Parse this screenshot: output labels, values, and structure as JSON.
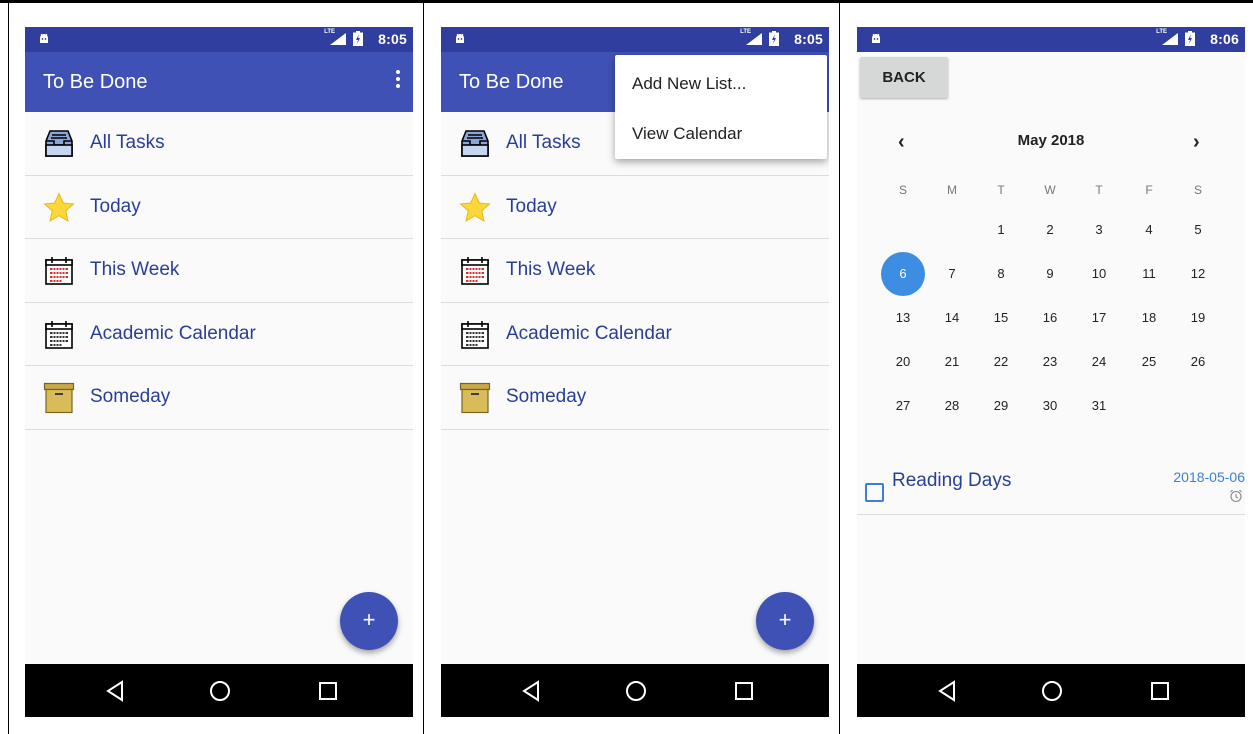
{
  "status": {
    "lte": "LTE",
    "time_a": "8:05",
    "time_b": "8:05",
    "time_c": "8:06"
  },
  "app": {
    "title": "To Be Done"
  },
  "lists": [
    {
      "label": "All Tasks",
      "icon": "inbox-tray-icon"
    },
    {
      "label": "Today",
      "icon": "star-icon"
    },
    {
      "label": "This Week",
      "icon": "calendar-week-icon"
    },
    {
      "label": "Academic Calendar",
      "icon": "calendar-icon"
    },
    {
      "label": "Someday",
      "icon": "archive-box-icon"
    }
  ],
  "fab": {
    "label": "+"
  },
  "menu": {
    "add_new_list": "Add New List...",
    "view_calendar": "View Calendar"
  },
  "calendar": {
    "back_label": "BACK",
    "prev": "‹",
    "next": "›",
    "month": "May 2018",
    "weekdays": [
      "S",
      "M",
      "T",
      "W",
      "T",
      "F",
      "S"
    ],
    "first_weekday_index": 2,
    "days_in_month": 31,
    "selected_day": "6"
  },
  "task": {
    "name": "Reading Days",
    "date": "2018-05-06",
    "done": false
  },
  "colors": {
    "primary": "#3f51b5",
    "primary_dark": "#303f9f",
    "selected_day": "#3d8de3",
    "list_text": "#2b3e96"
  }
}
